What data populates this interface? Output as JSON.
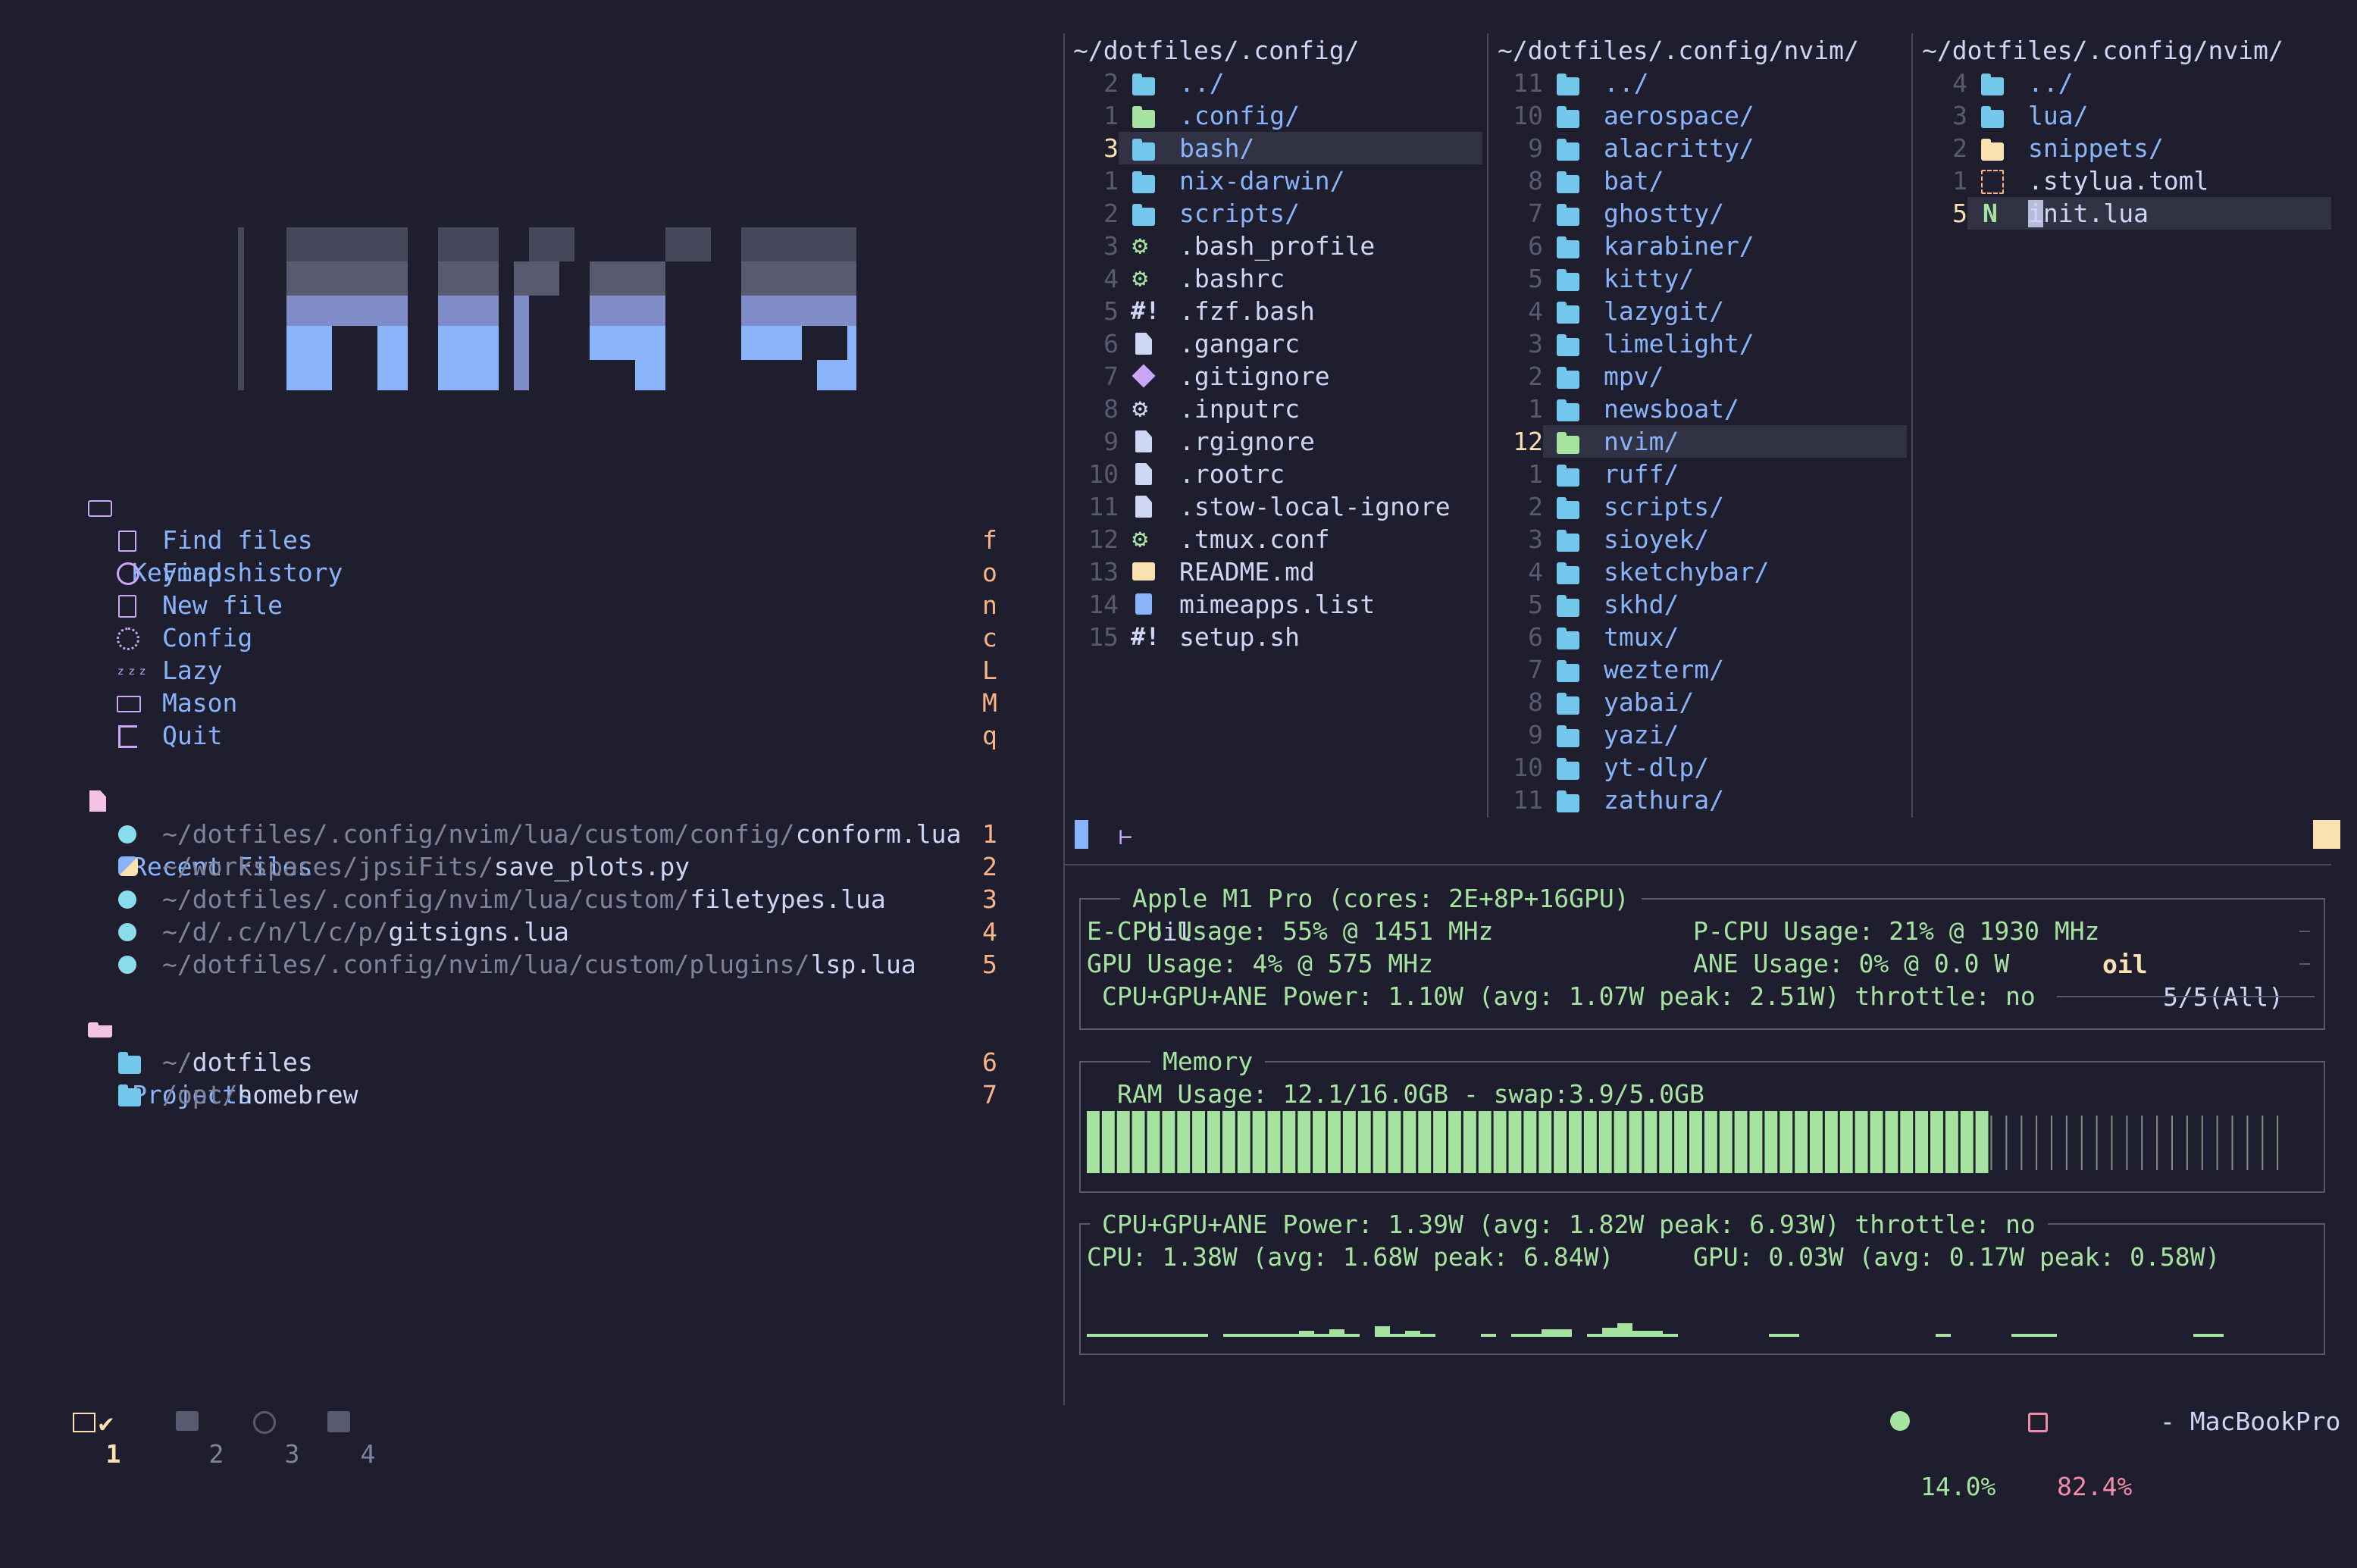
{
  "dashboard": {
    "keymaps_title": "Keymaps",
    "keymaps": [
      {
        "label": "Find files",
        "key": "f",
        "icon": "find-files-icon"
      },
      {
        "label": "Find history",
        "key": "o",
        "icon": "history-icon"
      },
      {
        "label": "New file",
        "key": "n",
        "icon": "new-file-icon"
      },
      {
        "label": "Config",
        "key": "c",
        "icon": "gear-icon"
      },
      {
        "label": "Lazy",
        "key": "L",
        "icon": "sleep-icon"
      },
      {
        "label": "Mason",
        "key": "M",
        "icon": "mason-icon"
      },
      {
        "label": "Quit",
        "key": "q",
        "icon": "quit-icon"
      }
    ],
    "recent_title": "Recent Files",
    "recent": [
      {
        "dir": "~/dotfiles/.config/nvim/lua/custom/config/",
        "file": "conform.lua",
        "key": "1",
        "icon": "lua-icon"
      },
      {
        "dir": "~/workspaces/jpsiFits/",
        "file": "save_plots.py",
        "key": "2",
        "icon": "python-icon"
      },
      {
        "dir": "~/dotfiles/.config/nvim/lua/custom/",
        "file": "filetypes.lua",
        "key": "3",
        "icon": "lua-icon"
      },
      {
        "dir": "~/d/.c/n/l/c/p/",
        "file": "gitsigns.lua",
        "key": "4",
        "icon": "lua-icon"
      },
      {
        "dir": "~/dotfiles/.config/nvim/lua/custom/plugins/",
        "file": "lsp.lua",
        "key": "5",
        "icon": "lua-icon"
      }
    ],
    "projects_title": "Projects",
    "projects": [
      {
        "dir": "~/",
        "name": "dotfiles",
        "key": "6"
      },
      {
        "dir": "/opt/",
        "name": "homebrew",
        "key": "7"
      }
    ]
  },
  "oil": {
    "pane1": {
      "title": "~/dotfiles/.config/",
      "rows": [
        {
          "n": "2",
          "name": "../",
          "icon": "folder"
        },
        {
          "n": "1",
          "name": ".config/",
          "icon": "config-folder"
        },
        {
          "n": "3",
          "name": "bash/",
          "icon": "folder",
          "current": true
        },
        {
          "n": "1",
          "name": "nix-darwin/",
          "icon": "folder"
        },
        {
          "n": "2",
          "name": "scripts/",
          "icon": "folder"
        },
        {
          "n": "3",
          "name": ".bash_profile",
          "icon": "gear"
        },
        {
          "n": "4",
          "name": ".bashrc",
          "icon": "gear"
        },
        {
          "n": "5",
          "name": ".fzf.bash",
          "icon": "shebang"
        },
        {
          "n": "6",
          "name": ".gangarc",
          "icon": "doc"
        },
        {
          "n": "7",
          "name": ".gitignore",
          "icon": "git"
        },
        {
          "n": "8",
          "name": ".inputrc",
          "icon": "gear-white"
        },
        {
          "n": "9",
          "name": ".rgignore",
          "icon": "doc"
        },
        {
          "n": "10",
          "name": ".rootrc",
          "icon": "doc"
        },
        {
          "n": "11",
          "name": ".stow-local-ignore",
          "icon": "doc"
        },
        {
          "n": "12",
          "name": ".tmux.conf",
          "icon": "gear"
        },
        {
          "n": "13",
          "name": "README.md",
          "icon": "markdown"
        },
        {
          "n": "14",
          "name": "mimeapps.list",
          "icon": "list"
        },
        {
          "n": "15",
          "name": "setup.sh",
          "icon": "shebang"
        }
      ]
    },
    "pane2": {
      "title": "~/dotfiles/.config/nvim/",
      "rows": [
        {
          "n": "11",
          "name": "../",
          "icon": "folder"
        },
        {
          "n": "10",
          "name": "aerospace/",
          "icon": "folder"
        },
        {
          "n": "9",
          "name": "alacritty/",
          "icon": "folder"
        },
        {
          "n": "8",
          "name": "bat/",
          "icon": "folder"
        },
        {
          "n": "7",
          "name": "ghostty/",
          "icon": "folder"
        },
        {
          "n": "6",
          "name": "karabiner/",
          "icon": "folder"
        },
        {
          "n": "5",
          "name": "kitty/",
          "icon": "folder"
        },
        {
          "n": "4",
          "name": "lazygit/",
          "icon": "folder"
        },
        {
          "n": "3",
          "name": "limelight/",
          "icon": "folder"
        },
        {
          "n": "2",
          "name": "mpv/",
          "icon": "folder"
        },
        {
          "n": "1",
          "name": "newsboat/",
          "icon": "folder"
        },
        {
          "n": "12",
          "name": "nvim/",
          "icon": "folder-green",
          "current": true
        },
        {
          "n": "1",
          "name": "ruff/",
          "icon": "folder"
        },
        {
          "n": "2",
          "name": "scripts/",
          "icon": "folder"
        },
        {
          "n": "3",
          "name": "sioyek/",
          "icon": "folder"
        },
        {
          "n": "4",
          "name": "sketchybar/",
          "icon": "folder"
        },
        {
          "n": "5",
          "name": "skhd/",
          "icon": "folder"
        },
        {
          "n": "6",
          "name": "tmux/",
          "icon": "folder"
        },
        {
          "n": "7",
          "name": "wezterm/",
          "icon": "folder"
        },
        {
          "n": "8",
          "name": "yabai/",
          "icon": "folder"
        },
        {
          "n": "9",
          "name": "yazi/",
          "icon": "folder"
        },
        {
          "n": "10",
          "name": "yt-dlp/",
          "icon": "folder"
        },
        {
          "n": "11",
          "name": "zathura/",
          "icon": "folder"
        }
      ]
    },
    "pane3": {
      "title": "~/dotfiles/.config/nvim/",
      "rows": [
        {
          "n": "4",
          "name": "../",
          "icon": "folder"
        },
        {
          "n": "3",
          "name": "lua/",
          "icon": "folder"
        },
        {
          "n": "2",
          "name": "snippets/",
          "icon": "folder-yellow"
        },
        {
          "n": "1",
          "name": ".stylua.toml",
          "icon": "toml"
        },
        {
          "n": "5",
          "name": "init.lua",
          "icon": "neovim",
          "current": true
        }
      ]
    },
    "status": {
      "mode_label": "oil",
      "right_name": "oil",
      "right_pos": "5/5(All)"
    }
  },
  "macmon": {
    "cpu_title": "Apple M1 Pro (cores: 2E+8P+16GPU)",
    "ecpu": "E-CPU Usage: 55% @ 1451 MHz",
    "pcpu": "P-CPU Usage: 21% @ 1930 MHz",
    "gpu": "GPU Usage: 4% @ 575 MHz",
    "ane": "ANE Usage: 0% @ 0.0 W",
    "power1": "CPU+GPU+ANE Power: 1.10W (avg: 1.07W peak: 2.51W) throttle: no",
    "mem_title": "Memory",
    "ram": "RAM Usage: 12.1/16.0GB - swap:3.9/5.0GB",
    "ram_fraction": 0.756,
    "power2": "CPU+GPU+ANE Power: 1.39W (avg: 1.82W peak: 6.93W) throttle: no",
    "cpu_power": "CPU: 1.38W (avg: 1.68W peak: 6.84W)",
    "gpu_power": "GPU: 0.03W (avg: 0.17W peak: 0.58W)"
  },
  "tmux": {
    "windows": [
      "1",
      "2",
      "3",
      "4"
    ],
    "cpu": "14.0%",
    "mem": "82.4%",
    "host": "- MacBookPro"
  },
  "colors": {
    "accent": "#89b4fa",
    "key": "#fab387",
    "green": "#a6e3a1",
    "yellow": "#f9e2af",
    "bg": "#1e1e2e"
  }
}
